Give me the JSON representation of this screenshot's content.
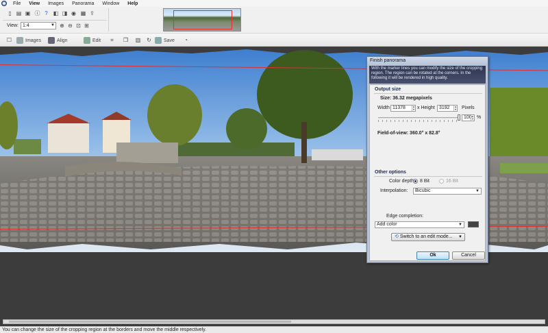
{
  "menu": {
    "items": [
      "File",
      "View",
      "Images",
      "Panorama",
      "Window",
      "Help"
    ]
  },
  "toolbar": {
    "view_label": "View:",
    "zoom_value": "1:4"
  },
  "toolbar2": {
    "images": "Images",
    "align": "Align",
    "edit": "Edit",
    "save": "Save"
  },
  "dialog": {
    "title": "Finish panorama",
    "banner_text": "With the marker lines you can modify the size of the cropping region. The region can be rotated at the corners. In the following it will be rendered in high quality.",
    "output_size": {
      "section_title": "Output size",
      "size_text": "Size: 36.32 megapixels",
      "width_label": "Width",
      "width_value": "11378",
      "height_label": "x Height",
      "height_value": "3192",
      "unit_label": "Pixels",
      "scale_value": "100",
      "scale_percent": 100,
      "percent_label": "%",
      "fov_text": "Field-of-view: 360.0° x 82.8°"
    },
    "other_options": {
      "section_title": "Other options",
      "color_depth_label": "Color depth",
      "option_8bit": "8 Bit",
      "option_16bit": "16 Bit",
      "interpolation_label": "Interpolation:",
      "interpolation_value": "Bicubic",
      "edge_label": "Edge completion:",
      "edge_value": "Add color",
      "edit_mode_button": "Switch to an edit mode..."
    },
    "ok": "Ok",
    "cancel": "Cancel"
  },
  "status": {
    "text": "You can change the size of the cropping region at the borders and move the middle respectively."
  },
  "colors": {
    "crop_line": "#e03030",
    "banner_bg": "#2d3550",
    "section_title": "#1c2a55"
  }
}
